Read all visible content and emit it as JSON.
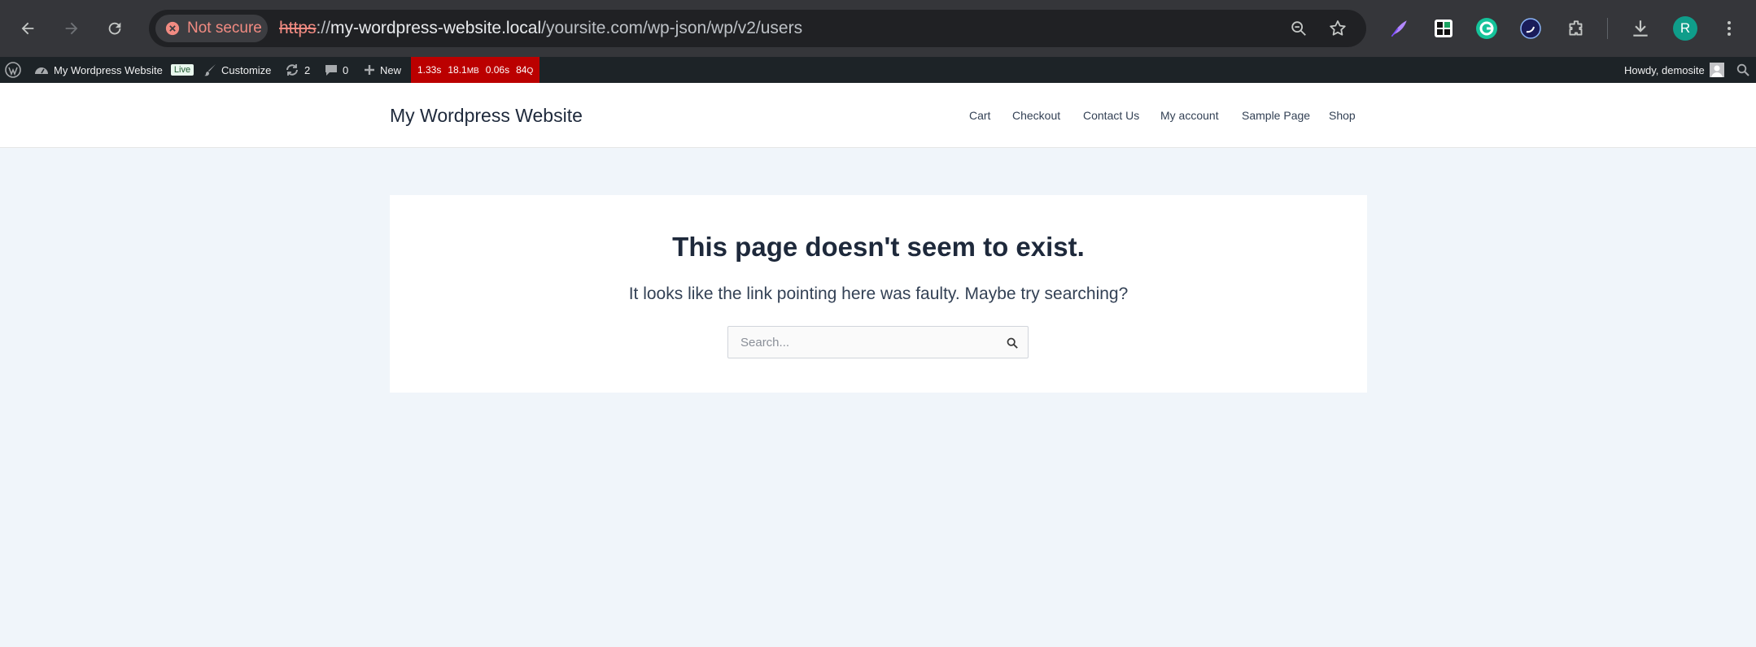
{
  "browser": {
    "security_label": "Not secure",
    "url_scheme": "https",
    "url_sep": "://",
    "url_host": "my-wordpress-website.local",
    "url_path": "/yoursite.com/wp-json/wp/v2/users",
    "profile_initial": "R",
    "icons": [
      "back-icon",
      "forward-icon",
      "reload-icon",
      "zoom-icon",
      "bookmark-star-icon",
      "quill-extension-icon",
      "grid-extension-icon",
      "grammarly-icon",
      "swirl-extension-icon",
      "extensions-puzzle-icon",
      "download-icon",
      "menu-dots-icon"
    ]
  },
  "adminbar": {
    "site_name": "My Wordpress Website",
    "live_label": "Live",
    "customize_label": "Customize",
    "updates_count": "2",
    "comments_count": "0",
    "new_label": "New",
    "qm": {
      "time": "1.33s",
      "memory": "18.1",
      "memory_unit": "MB",
      "db_time": "0.06s",
      "queries": "84",
      "queries_unit": "Q"
    },
    "howdy": "Howdy, demosite"
  },
  "site": {
    "title": "My Wordpress Website",
    "menu": [
      "Cart",
      "Checkout",
      "Contact Us",
      "My account",
      "Sample Page",
      "Shop"
    ]
  },
  "notfound": {
    "heading": "This page doesn't seem to exist.",
    "message": "It looks like the link pointing here was faulty. Maybe try searching?",
    "search_placeholder": "Search..."
  },
  "colors": {
    "adminbar_bg": "#1d2327",
    "qm_bg": "#bb0000",
    "page_bg": "#f0f5fa",
    "insecure_red": "#f28b82"
  }
}
